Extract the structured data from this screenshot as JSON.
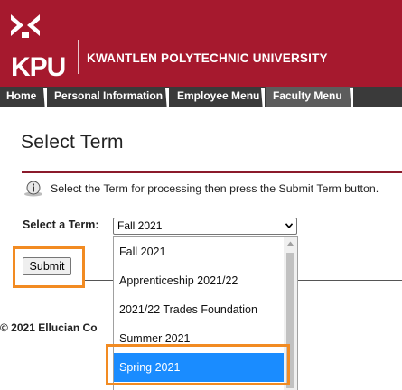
{
  "header": {
    "logo_text": "KPU",
    "university_name": "KWANTLEN POLYTECHNIC UNIVERSITY",
    "brand_color": "#a6192e"
  },
  "nav": {
    "tabs": [
      {
        "label": "Home"
      },
      {
        "label": "Personal Information"
      },
      {
        "label": "Employee Menu"
      },
      {
        "label": "Faculty Menu"
      }
    ],
    "active_tab": "Faculty Menu"
  },
  "main": {
    "title": "Select Term",
    "info_icon": "info-icon",
    "info_text": "Select the Term for processing then press the Submit Term button.",
    "term_label": "Select a Term:",
    "term_select": {
      "selected_value": "Fall 2021",
      "options": [
        "Fall 2021",
        "Apprenticeship 2021/22",
        "2021/22 Trades Foundation",
        "Summer 2021",
        "Spring 2021"
      ],
      "highlighted_option": "Spring 2021"
    },
    "submit_label": "Submit",
    "highlight_color": "#f28b22"
  },
  "footer": {
    "copyright": "© 2021 Ellucian Co"
  }
}
